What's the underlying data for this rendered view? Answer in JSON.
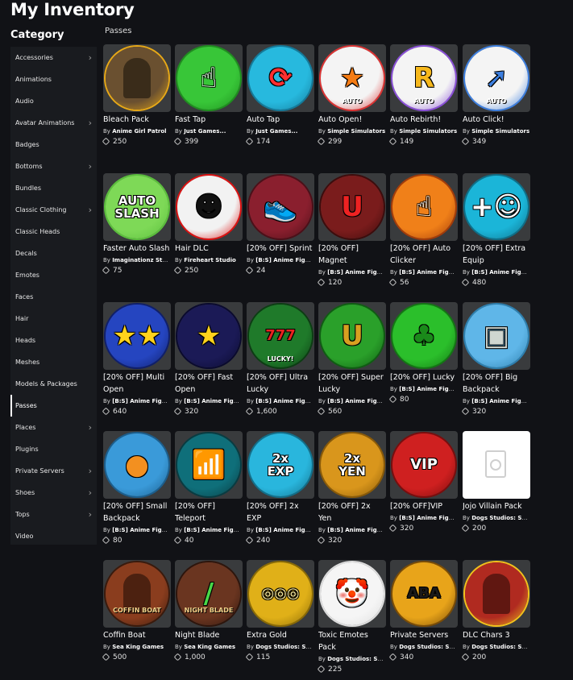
{
  "page_title": "My Inventory",
  "category_title": "Category",
  "section_label": "Passes",
  "categories": [
    {
      "label": "Accessories",
      "chevron": true
    },
    {
      "label": "Animations",
      "chevron": false
    },
    {
      "label": "Audio",
      "chevron": false
    },
    {
      "label": "Avatar Animations",
      "chevron": true
    },
    {
      "label": "Badges",
      "chevron": false
    },
    {
      "label": "Bottoms",
      "chevron": true
    },
    {
      "label": "Bundles",
      "chevron": false
    },
    {
      "label": "Classic Clothing",
      "chevron": true
    },
    {
      "label": "Classic Heads",
      "chevron": false
    },
    {
      "label": "Decals",
      "chevron": false
    },
    {
      "label": "Emotes",
      "chevron": false
    },
    {
      "label": "Faces",
      "chevron": false
    },
    {
      "label": "Hair",
      "chevron": false
    },
    {
      "label": "Heads",
      "chevron": false
    },
    {
      "label": "Meshes",
      "chevron": false
    },
    {
      "label": "Models & Packages",
      "chevron": false
    },
    {
      "label": "Passes",
      "chevron": false,
      "active": true
    },
    {
      "label": "Places",
      "chevron": true
    },
    {
      "label": "Plugins",
      "chevron": false
    },
    {
      "label": "Private Servers",
      "chevron": true
    },
    {
      "label": "Shoes",
      "chevron": true
    },
    {
      "label": "Tops",
      "chevron": true
    },
    {
      "label": "Video",
      "chevron": false
    }
  ],
  "items": [
    {
      "name": "Bleach Pack",
      "by": "By",
      "creator": "Anime Girl Patrol",
      "price": "250",
      "icon": "anime-characters-icon",
      "bg": "#6a5030",
      "ring": "#e7a817",
      "glyph": "",
      "glyph_color": "#fff"
    },
    {
      "name": "Fast Tap",
      "by": "By",
      "creator": "Just Games...",
      "price": "399",
      "icon": "tap-hand-icon",
      "bg": "#38c638",
      "ring": "#1f8f1f",
      "glyph": "☝",
      "glyph_color": "#fff"
    },
    {
      "name": "Auto Tap",
      "by": "By",
      "creator": "Just Games...",
      "price": "174",
      "icon": "auto-tap-hand-icon",
      "bg": "#27b9de",
      "ring": "#137a9a",
      "glyph": "⟳",
      "glyph_color": "#ff3030"
    },
    {
      "name": "Auto Open!",
      "by": "By",
      "creator": "Simple Simulators",
      "price": "299",
      "icon": "star-auto-icon",
      "bg": "#f4f4f4",
      "ring": "#d33",
      "glyph": "★",
      "glyph_color": "#f57c14",
      "sub": "AUTO"
    },
    {
      "name": "Auto Rebirth!",
      "by": "By",
      "creator": "Simple Simulators",
      "price": "149",
      "icon": "rebirth-auto-icon",
      "bg": "#f4f4f4",
      "ring": "#8a4fd8",
      "glyph": "R",
      "glyph_color": "#f6b81c",
      "sub": "AUTO"
    },
    {
      "name": "Auto Click!",
      "by": "By",
      "creator": "Simple Simulators",
      "price": "349",
      "icon": "cursor-auto-icon",
      "bg": "#f4f4f4",
      "ring": "#3d7fe0",
      "glyph": "➚",
      "glyph_color": "#3d7fe0",
      "sub": "AUTO"
    },
    {
      "name": "Faster Auto Slash",
      "by": "By",
      "creator": "Imaginationz Stu...",
      "price": "75",
      "icon": "auto-slash-icon",
      "bg": "#7ed957",
      "ring": "#5bbf3c",
      "glyph": "AUTO\nSLASH",
      "glyph_color": "#fff"
    },
    {
      "name": "Hair DLC",
      "by": "By",
      "creator": "Fireheart Studio",
      "price": "250",
      "icon": "hair-character-icon",
      "bg": "#f2f2f2",
      "ring": "#d11",
      "glyph": "☻",
      "glyph_color": "#111"
    },
    {
      "name": "[20% OFF] Sprint",
      "by": "By",
      "creator": "[B:S] Anime Fight...",
      "price": "24",
      "icon": "sneaker-icon",
      "bg": "#8a1f2e",
      "ring": "#4c0f18",
      "glyph": "👟",
      "glyph_color": "#e23"
    },
    {
      "name": "[20% OFF] Magnet",
      "by": "By",
      "creator": "[B:S] Anime Fight...",
      "price": "120",
      "icon": "magnet-icon",
      "bg": "#7a1c1c",
      "ring": "#3d0c0c",
      "glyph": "U",
      "glyph_color": "#e22"
    },
    {
      "name": "[20% OFF] Auto Clicker",
      "by": "By",
      "creator": "[B:S] Anime Fight...",
      "price": "56",
      "icon": "clicker-fire-icon",
      "bg": "#f08019",
      "ring": "#a33b09",
      "glyph": "☝",
      "glyph_color": "#fff"
    },
    {
      "name": "[20% OFF] Extra Equip",
      "by": "By",
      "creator": "[B:S] Anime Fight...",
      "price": "480",
      "icon": "plus-smiley-icon",
      "bg": "#1bb5d8",
      "ring": "#0e6f88",
      "glyph": "+☺",
      "glyph_color": "#fff"
    },
    {
      "name": "[20% OFF] Multi Open",
      "by": "By",
      "creator": "[B:S] Anime Fight...",
      "price": "640",
      "icon": "multi-star-icon",
      "bg": "#2545c0",
      "ring": "#0f1f6b",
      "glyph": "★★",
      "glyph_color": "#ffd21c"
    },
    {
      "name": "[20% OFF] Fast Open",
      "by": "By",
      "creator": "[B:S] Anime Fight...",
      "price": "320",
      "icon": "star-speed-icon",
      "bg": "#1b1a56",
      "ring": "#0a0a2e",
      "glyph": "★",
      "glyph_color": "#ffd21c"
    },
    {
      "name": "[20% OFF] Ultra Lucky",
      "by": "By",
      "creator": "[B:S] Anime Fight...",
      "price": "1,600",
      "icon": "slot-machine-icon",
      "bg": "#1f7a2a",
      "ring": "#0c3e13",
      "glyph": "777",
      "glyph_color": "#e8221f",
      "sub": "LUCKY!"
    },
    {
      "name": "[20% OFF] Super Lucky",
      "by": "By",
      "creator": "[B:S] Anime Fight...",
      "price": "560",
      "icon": "horseshoe-icon",
      "bg": "#2aa02a",
      "ring": "#0f5e12",
      "glyph": "U",
      "glyph_color": "#d8a020"
    },
    {
      "name": "[20% OFF] Lucky",
      "by": "By",
      "creator": "[B:S] Anime Fight...",
      "price": "80",
      "icon": "clover-icon",
      "bg": "#2bbf2b",
      "ring": "#137813",
      "glyph": "♣",
      "glyph_color": "#1a8a1a"
    },
    {
      "name": "[20% OFF] Big Backpack",
      "by": "By",
      "creator": "[B:S] Anime Fight...",
      "price": "320",
      "icon": "robot-backpack-icon",
      "bg": "#5fb6e8",
      "ring": "#2d7fae",
      "glyph": "▣",
      "glyph_color": "#cfd6d0"
    },
    {
      "name": "[20% OFF] Small Backpack",
      "by": "By",
      "creator": "[B:S] Anime Fight...",
      "price": "80",
      "icon": "dragon-ball-icon",
      "bg": "#3a9ad9",
      "ring": "#1b5e8d",
      "glyph": "●",
      "glyph_color": "#f39020"
    },
    {
      "name": "[20% OFF] Teleport",
      "by": "By",
      "creator": "[B:S] Anime Fight...",
      "price": "40",
      "icon": "teleport-device-icon",
      "bg": "#0f6f7a",
      "ring": "#083c42",
      "glyph": "📶",
      "glyph_color": "#39e0e0"
    },
    {
      "name": "[20% OFF] 2x EXP",
      "by": "By",
      "creator": "[B:S] Anime Fight...",
      "price": "240",
      "icon": "2x-exp-icon",
      "bg": "#29b6dd",
      "ring": "#126f8a",
      "glyph": "2x\nEXP",
      "glyph_color": "#fff"
    },
    {
      "name": "[20% OFF] 2x Yen",
      "by": "By",
      "creator": "[B:S] Anime Fight...",
      "price": "320",
      "icon": "2x-yen-icon",
      "bg": "#d9961c",
      "ring": "#8a5a07",
      "glyph": "2x\nYEN",
      "glyph_color": "#fff"
    },
    {
      "name": "[20% OFF]VIP",
      "by": "By",
      "creator": "[B:S] Anime Fight...",
      "price": "320",
      "icon": "vip-icon",
      "bg": "#cf2020",
      "ring": "#7a0d0d",
      "glyph": "VIP",
      "glyph_color": "#fff"
    },
    {
      "name": "Jojo Villain Pack",
      "by": "By",
      "creator": "Dogs Studios: So...",
      "price": "200",
      "icon": "no-image-icon",
      "bg": "",
      "ring": "",
      "glyph": "",
      "glyph_color": "#ccc",
      "placeholder": true
    },
    {
      "name": "Coffin Boat",
      "by": "By",
      "creator": "Sea King Games",
      "price": "500",
      "icon": "coffin-boat-icon",
      "bg": "#8a3d1e",
      "ring": "#3a1a0c",
      "glyph": "",
      "glyph_color": "#fff",
      "sub": "COFFIN BOAT"
    },
    {
      "name": "Night Blade",
      "by": "By",
      "creator": "Sea King Games",
      "price": "1,000",
      "icon": "night-blade-icon",
      "bg": "#6a3520",
      "ring": "#2e150c",
      "glyph": "/",
      "glyph_color": "#48d848",
      "sub": "NIGHT BLADE"
    },
    {
      "name": "Extra Gold",
      "by": "By",
      "creator": "Dogs Studios: So...",
      "price": "115",
      "icon": "gold-coins-icon",
      "bg": "#e0b018",
      "ring": "#8a6a05",
      "glyph": "◎◎◎",
      "glyph_color": "#fff2a8"
    },
    {
      "name": "Toxic Emotes Pack",
      "by": "By",
      "creator": "Dogs Studios: So...",
      "price": "225",
      "icon": "clown-face-icon",
      "bg": "#f5f5f5",
      "ring": "#dddddd",
      "glyph": "🤡",
      "glyph_color": "#e22"
    },
    {
      "name": "Private Servers",
      "by": "By",
      "creator": "Dogs Studios: So...",
      "price": "340",
      "icon": "aba-logo-icon",
      "bg": "#e8a41a",
      "ring": "#7a4c06",
      "glyph": "ABA",
      "glyph_color": "#1a1a1a"
    },
    {
      "name": "DLC Chars 3",
      "by": "By",
      "creator": "Dogs Studios: So...",
      "price": "200",
      "icon": "anime-characters-icon",
      "bg": "#b02a20",
      "ring": "#f2c11c",
      "glyph": "",
      "glyph_color": "#fff"
    }
  ]
}
